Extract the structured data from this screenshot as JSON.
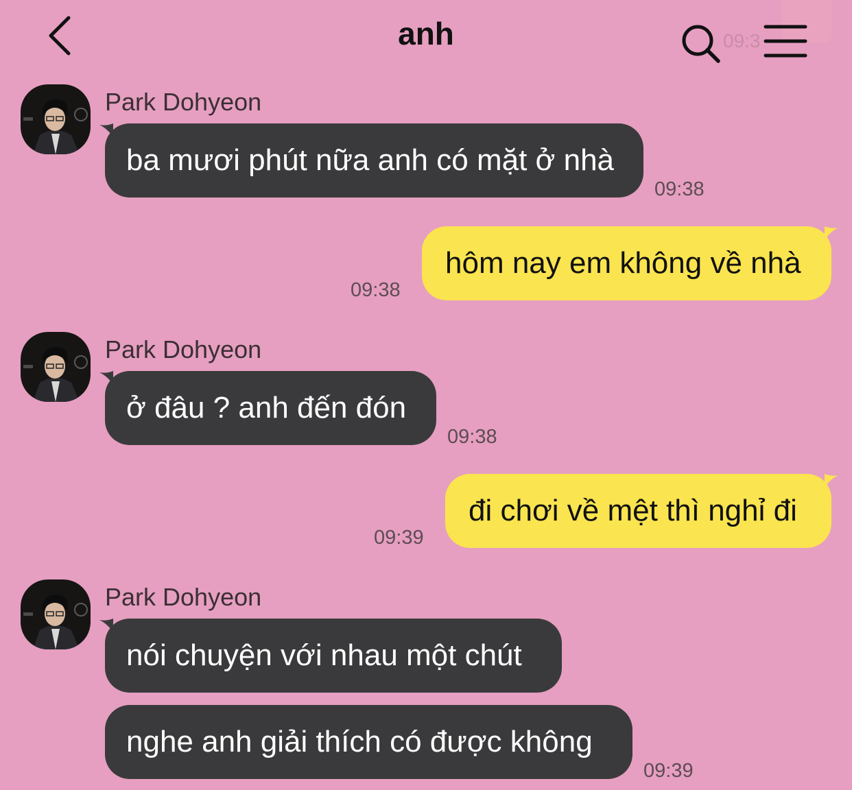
{
  "header": {
    "title": "anh",
    "ghost_time": "09:3"
  },
  "messages": [
    {
      "sender": "Park Dohyeon",
      "text": "ba mươi phút nữa anh có mặt ở nhà",
      "time": "09:38"
    },
    {
      "text": "hôm nay em không về nhà",
      "time": "09:38"
    },
    {
      "sender": "Park Dohyeon",
      "text": "ở đâu ? anh đến đón",
      "time": "09:38"
    },
    {
      "text": "đi chơi về mệt thì nghỉ đi",
      "time": "09:39"
    },
    {
      "sender": "Park Dohyeon",
      "text": "nói chuyện với nhau một chút"
    },
    {
      "text": "nghe anh giải thích có được không",
      "time": "09:39"
    }
  ],
  "colors": {
    "background": "#E69FC0",
    "incoming_bubble": "#3A3A3C",
    "outgoing_bubble": "#FAE44F"
  },
  "icons": {
    "back": "chevron-left-icon",
    "search": "search-icon",
    "menu": "menu-icon"
  }
}
